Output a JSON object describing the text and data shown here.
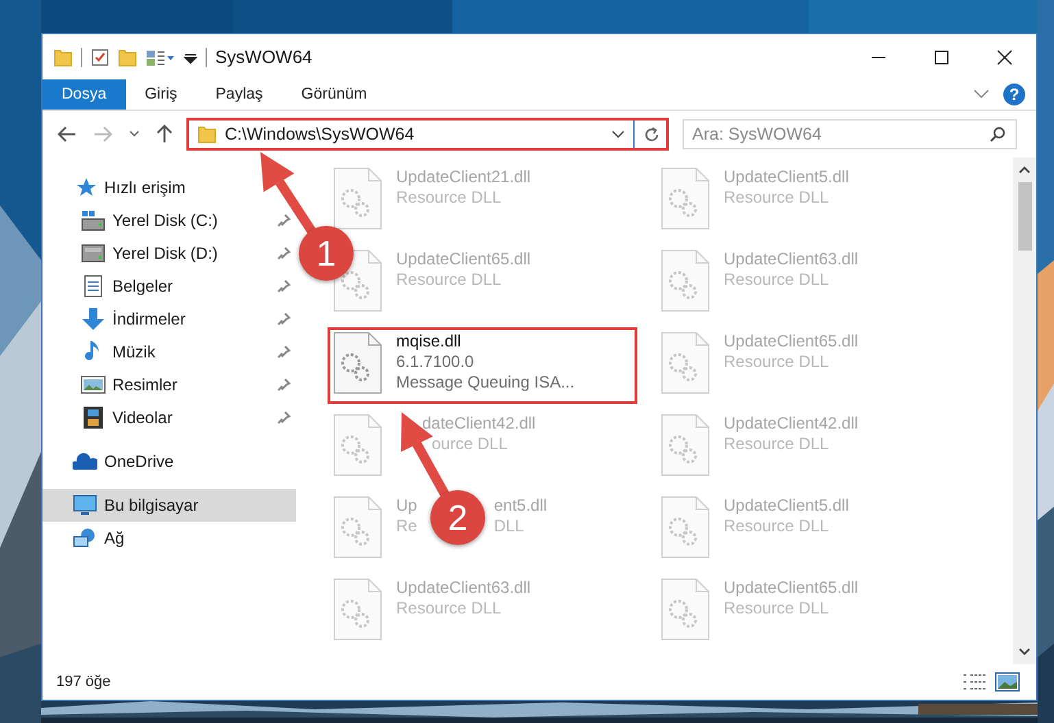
{
  "window": {
    "title": "SysWOW64"
  },
  "ribbon_tabs": [
    {
      "label": "Dosya",
      "selected": true
    },
    {
      "label": "Giriş",
      "selected": false
    },
    {
      "label": "Paylaş",
      "selected": false
    },
    {
      "label": "Görünüm",
      "selected": false
    }
  ],
  "help": "?",
  "address_bar": {
    "path": "C:\\Windows\\SysWOW64",
    "highlighted": true
  },
  "search": {
    "placeholder": "Ara: SysWOW64"
  },
  "sidebar": [
    {
      "label": "Hızlı erişim",
      "kind": "star",
      "selected": false,
      "pinned": false,
      "children": [
        {
          "label": "Yerel Disk (C:)",
          "kind": "system-drive",
          "selected": false,
          "pinned": true
        },
        {
          "label": "Yerel Disk (D:)",
          "kind": "drive",
          "selected": false,
          "pinned": true
        },
        {
          "label": "Belgeler",
          "kind": "documents",
          "selected": false,
          "pinned": true
        },
        {
          "label": "İndirmeler",
          "kind": "download",
          "selected": false,
          "pinned": true
        },
        {
          "label": "Müzik",
          "kind": "music",
          "selected": false,
          "pinned": true
        },
        {
          "label": "Resimler",
          "kind": "pictures",
          "selected": false,
          "pinned": true
        },
        {
          "label": "Videolar",
          "kind": "videos",
          "selected": false,
          "pinned": true
        }
      ]
    },
    {
      "label": "OneDrive",
      "kind": "cloud",
      "selected": false,
      "pinned": false
    },
    {
      "label": "Bu bilgisayar",
      "kind": "computer",
      "selected": true,
      "pinned": false
    },
    {
      "label": "Ağ",
      "kind": "network",
      "selected": false,
      "pinned": false
    }
  ],
  "files": [
    {
      "kind": "plain",
      "name": "UpdateClient21.dll",
      "lines": [
        "Resource DLL"
      ],
      "faded": true,
      "highlighted": false
    },
    {
      "kind": "plain",
      "name": "UpdateClient5.dll",
      "lines": [
        "Resource DLL"
      ],
      "faded": true,
      "highlighted": false
    },
    {
      "kind": "plain",
      "name": "UpdateClient65.dll",
      "lines": [
        "Resource DLL"
      ],
      "faded": true,
      "highlighted": false
    },
    {
      "kind": "plain",
      "name": "UpdateClient63.dll",
      "lines": [
        "Resource DLL"
      ],
      "faded": true,
      "highlighted": false
    },
    {
      "kind": "plain",
      "name": "mqise.dll",
      "lines": [
        "6.1.7100.0",
        "Message Queuing ISA..."
      ],
      "faded": false,
      "highlighted": true
    },
    {
      "kind": "plain",
      "name": "UpdateClient65.dll",
      "lines": [
        "Resource DLL"
      ],
      "faded": true,
      "highlighted": false
    },
    {
      "kind": "covered-start",
      "name": "dateClient42.dll",
      "lines": [
        "ource DLL"
      ],
      "faded": true,
      "highlighted": false
    },
    {
      "kind": "plain",
      "name": "UpdateClient42.dll",
      "lines": [
        "Resource DLL"
      ],
      "faded": true,
      "highlighted": false
    },
    {
      "kind": "covered-middle",
      "name": [
        "Up",
        "ent5.dll"
      ],
      "lines": [
        [
          "Re",
          "DLL"
        ]
      ],
      "faded": true,
      "highlighted": false
    },
    {
      "kind": "plain",
      "name": "UpdateClient5.dll",
      "lines": [
        "Resource DLL"
      ],
      "faded": true,
      "highlighted": false
    },
    {
      "kind": "plain",
      "name": "UpdateClient63.dll",
      "lines": [
        "Resource DLL"
      ],
      "faded": true,
      "highlighted": false
    },
    {
      "kind": "plain",
      "name": "UpdateClient65.dll",
      "lines": [
        "Resource DLL"
      ],
      "faded": true,
      "highlighted": false
    }
  ],
  "status_bar": {
    "count": "197 öğe"
  },
  "annotations": [
    {
      "number": "1"
    },
    {
      "number": "2"
    }
  ]
}
